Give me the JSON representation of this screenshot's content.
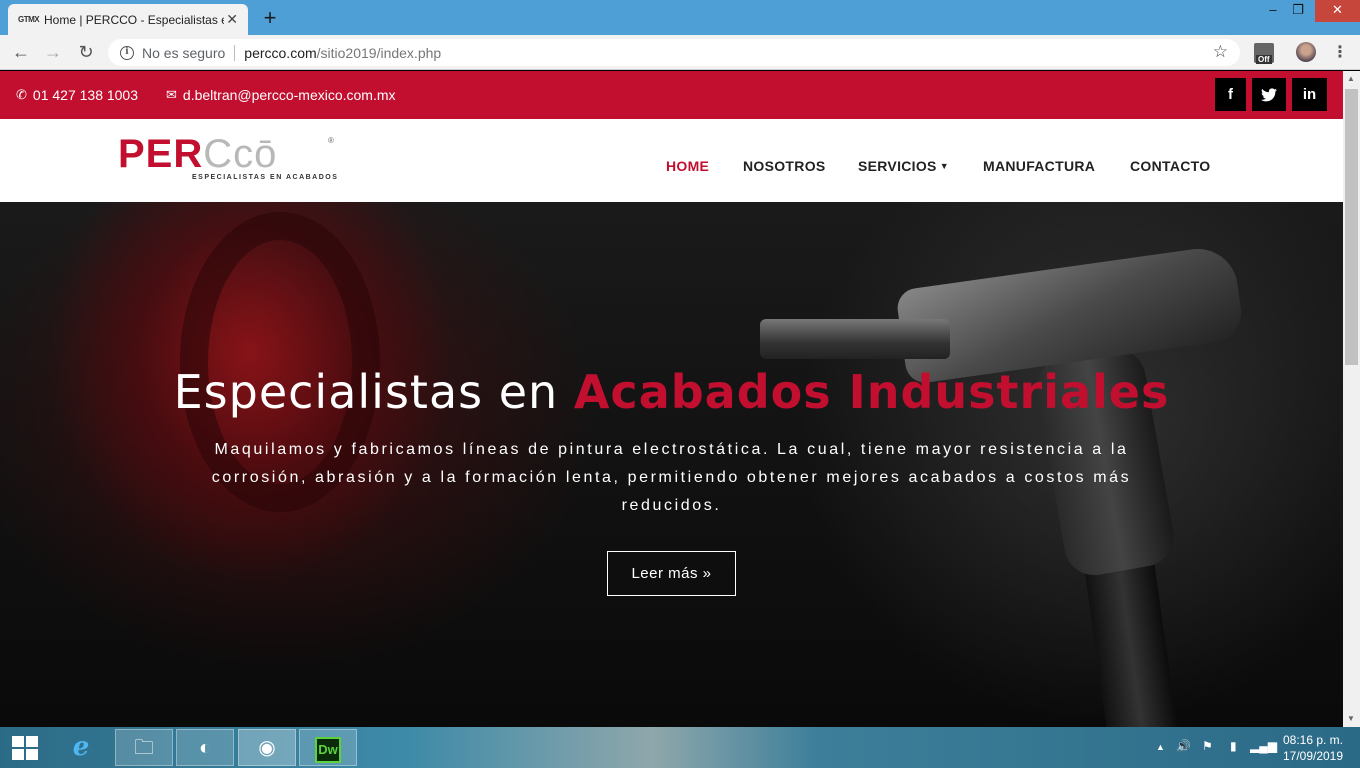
{
  "browser": {
    "tab_title": "Home | PERCCO - Especialistas en Acabados",
    "tab_favicon": "GTMX",
    "security": "No es seguro",
    "url_host": "percco.com",
    "url_path": "/sitio2019/index.php",
    "ext_badge": "Off"
  },
  "topbar": {
    "phone": "01 427 138 1003",
    "email": "d.beltran@percco-mexico.com.mx",
    "social": [
      "f",
      "t",
      "in"
    ]
  },
  "logo": {
    "main_a": "PER",
    "main_b": "Ccō",
    "registered": "®",
    "tagline": "ESPECIALISTAS EN ACABADOS"
  },
  "nav": {
    "home": "HOME",
    "nosotros": "NOSOTROS",
    "servicios": "SERVICIOS",
    "manufactura": "MANUFACTURA",
    "contacto": "CONTACTO"
  },
  "hero": {
    "title_plain": "Especialistas en ",
    "title_accent": "Acabados Industriales",
    "text": "Maquilamos y fabricamos líneas de pintura electrostática. La cual, tiene mayor resistencia a la corrosión, abrasión y a la formación lenta, permitiendo obtener mejores acabados a costos más reducidos.",
    "button": "Leer más »"
  },
  "taskbar": {
    "dw_label": "Dw",
    "time": "08:16 p. m.",
    "date": "17/09/2019"
  },
  "colors": {
    "brand_red": "#c20f2f",
    "chrome_blue": "#4f9fd7"
  }
}
